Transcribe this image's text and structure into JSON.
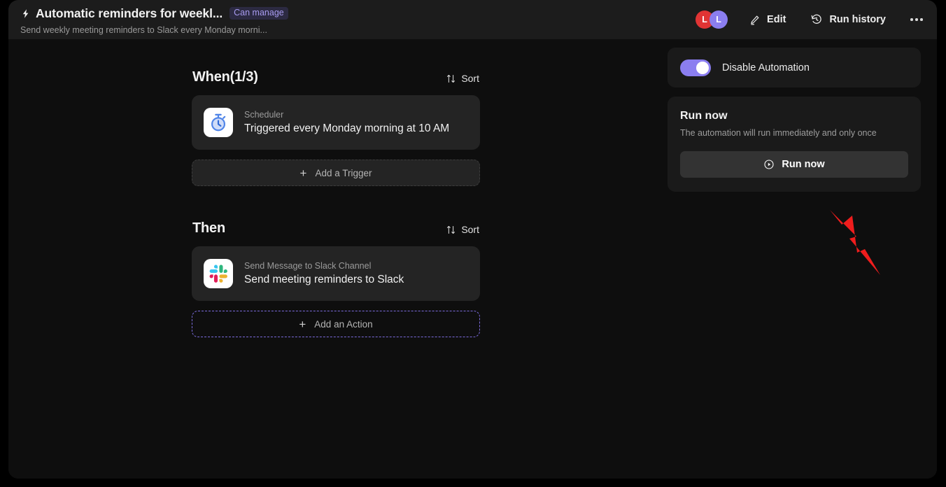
{
  "header": {
    "bolt_icon": "lightning-bolt-icon",
    "title": "Automatic reminders for weekl...",
    "badge": "Can manage",
    "subtitle": "Send weekly meeting reminders to Slack every Monday morni...",
    "avatars": [
      {
        "initial": "L",
        "color": "#e03434"
      },
      {
        "initial": "L",
        "color": "#8b7ef0"
      }
    ],
    "actions": [
      {
        "label": "Edit",
        "icon": "pencil-icon"
      },
      {
        "label": "Run history",
        "icon": "history-icon"
      }
    ],
    "more_label": "more-options"
  },
  "flow": {
    "when": {
      "title": "When(1/3)",
      "sort_label": "Sort",
      "sort_icon": "sort-arrows-icon",
      "steps": [
        {
          "icon": "scheduler-stopwatch-icon",
          "kind": "Scheduler",
          "name": "Triggered every Monday morning at 10 AM"
        }
      ],
      "add_label": "Add a Trigger",
      "add_icon": "plus-icon"
    },
    "then": {
      "title": "Then",
      "sort_label": "Sort",
      "sort_icon": "sort-arrows-icon",
      "steps": [
        {
          "icon": "slack-icon",
          "kind": "Send Message to Slack Channel",
          "name": "Send meeting reminders to Slack"
        }
      ],
      "add_label": "Add an Action",
      "add_icon": "plus-icon"
    }
  },
  "panel": {
    "disable": {
      "label": "Disable Automation",
      "enabled": true
    },
    "run_now": {
      "title": "Run now",
      "description": "The automation will run immediately and only once",
      "button_label": "Run now",
      "button_icon": "play-circle-icon"
    }
  },
  "annotation": {
    "arrow": "red-pointer-arrow",
    "color": "#ef1d1d",
    "target": "Run now"
  },
  "colors": {
    "accent_purple": "#8b7ef0",
    "badge_text": "#a89bf0",
    "window_bg": "#0e0e0e",
    "header_bg": "#1c1c1c",
    "card_bg": "#242424",
    "panel_bg": "#1a1a1a"
  }
}
